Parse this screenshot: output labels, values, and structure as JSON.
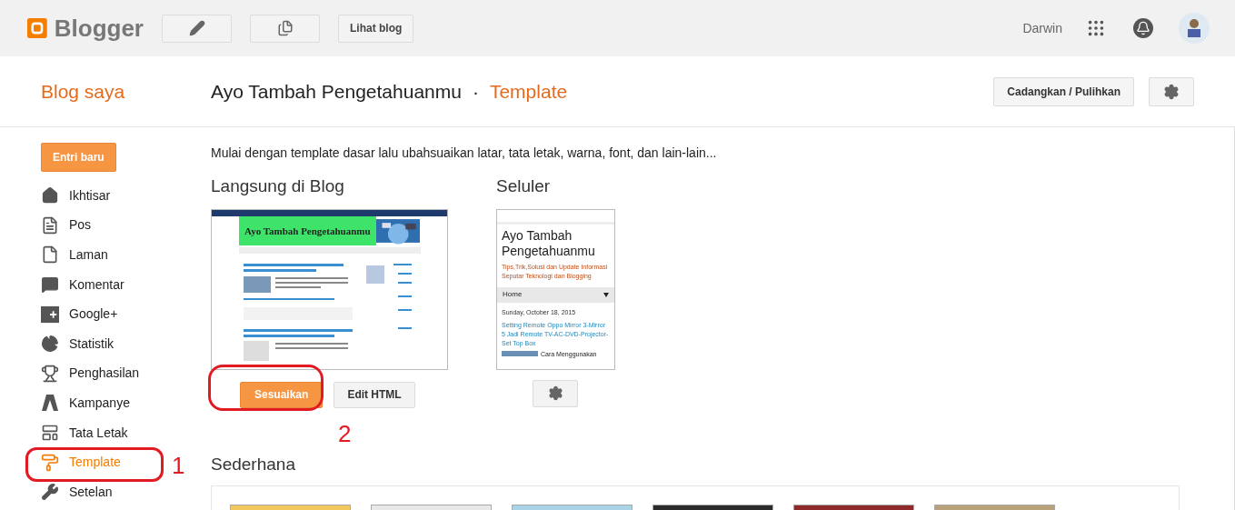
{
  "topbar": {
    "logo": "Blogger",
    "view_blog": "Lihat blog",
    "user": "Darwin"
  },
  "header": {
    "my_blogs": "Blog saya",
    "blog_name": "Ayo Tambah Pengetahuanmu",
    "separator": "·",
    "page": "Template",
    "backup_button": "Cadangkan / Pulihkan"
  },
  "sidebar": {
    "new_post": "Entri baru",
    "items": [
      {
        "label": "Ikhtisar",
        "kind": "home",
        "selected": false
      },
      {
        "label": "Pos",
        "kind": "posts",
        "selected": false
      },
      {
        "label": "Laman",
        "kind": "pages",
        "selected": false
      },
      {
        "label": "Komentar",
        "kind": "comments",
        "selected": false
      },
      {
        "label": "Google+",
        "kind": "gplus",
        "selected": false
      },
      {
        "label": "Statistik",
        "kind": "stats",
        "selected": false
      },
      {
        "label": "Penghasilan",
        "kind": "earnings",
        "selected": false
      },
      {
        "label": "Kampanye",
        "kind": "campaigns",
        "selected": false
      },
      {
        "label": "Tata Letak",
        "kind": "layout",
        "selected": false
      },
      {
        "label": "Template",
        "kind": "template",
        "selected": true
      },
      {
        "label": "Setelan",
        "kind": "settings",
        "selected": false
      }
    ]
  },
  "intro": "Mulai dengan template dasar lalu ubahsuaikan latar, tata letak, warna, font, dan lain-lain...",
  "live": {
    "heading": "Langsung di Blog",
    "preview_title": "Ayo Tambah Pengetahuanmu",
    "customize_button": "Sesuaikan",
    "edit_html_button": "Edit HTML"
  },
  "mobile": {
    "heading": "Seluler",
    "preview_title": "Ayo Tambah Pengetahuanmu",
    "preview_tagline": "Tips,Trik,Solusi dan Update Informasi Seputar Teknologi dan Blogging",
    "menu": "Home",
    "date": "Sunday, October 18, 2015",
    "post_title": "Setting Remote Oppo Mirror 3-Mirror 5 Jadi Remote TV-AC-DVD-Projector-Set Top Box",
    "post_snippet": "Cara Menggunakan"
  },
  "simple": {
    "heading": "Sederhana",
    "thumbnails": [
      {
        "color": "#f2c75c"
      },
      {
        "color": "#e8e8e8"
      },
      {
        "color": "#a9d3e6"
      },
      {
        "color": "#2b2b2b"
      },
      {
        "color": "#8e2a2a"
      },
      {
        "color": "#b9a27a"
      }
    ]
  },
  "annotations": [
    {
      "number": "1"
    },
    {
      "number": "2"
    }
  ]
}
